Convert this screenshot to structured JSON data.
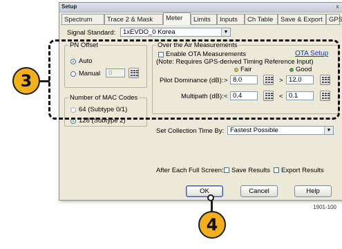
{
  "dialog": {
    "title": "Setup",
    "close_glyph": "x",
    "tabs": [
      "Spectrum",
      "Trace 2 & Mask",
      "Meter",
      "Limits",
      "Inputs",
      "Ch Table",
      "Save & Export",
      "GPS"
    ],
    "active_tab": "Meter"
  },
  "signal_standard": {
    "label": "Signal Standard:",
    "value": "1xEVDO_0 Korea"
  },
  "pn_offset": {
    "title": "PN Offset",
    "auto_label": "Auto",
    "manual_label": "Manual",
    "manual_value": "0",
    "selected": "Auto"
  },
  "mac_codes": {
    "title": "Number of MAC Codes",
    "option_64": "64 (Subtype 0/1)",
    "option_128": "128 (Subtype 2)",
    "selected": "128 (Subtype 2)"
  },
  "ota": {
    "title": "Over the Air Measurements",
    "enable_label": "Enable OTA Measurements",
    "note": "(Note: Requires GPS-derived Timing Reference Input)",
    "setup_link": "OTA Setup",
    "fair_label": "Fair",
    "good_label": "Good",
    "fair_color": "#e3c21b",
    "good_color": "#2fae2f",
    "pilot_label": "Pilot Dominance (dB):",
    "pilot_op": ">",
    "pilot_fair": "8.0",
    "pilot_good": "12.0",
    "multipath_label": "Multipath (dB):",
    "multipath_op": "<",
    "multipath_fair": "0.4",
    "multipath_good": "0.1"
  },
  "collection": {
    "label": "Set Collection Time By:",
    "value": "Fastest Possible"
  },
  "after_full_screen": {
    "label": "After Each Full Screen:",
    "save_label": "Save Results",
    "export_label": "Export Results"
  },
  "buttons": {
    "ok": "OK",
    "cancel": "Cancel",
    "help": "Help"
  },
  "callouts": {
    "step3": "3",
    "step4": "4",
    "badge_color": "#f2b01e"
  },
  "figure_id": "1901-100"
}
